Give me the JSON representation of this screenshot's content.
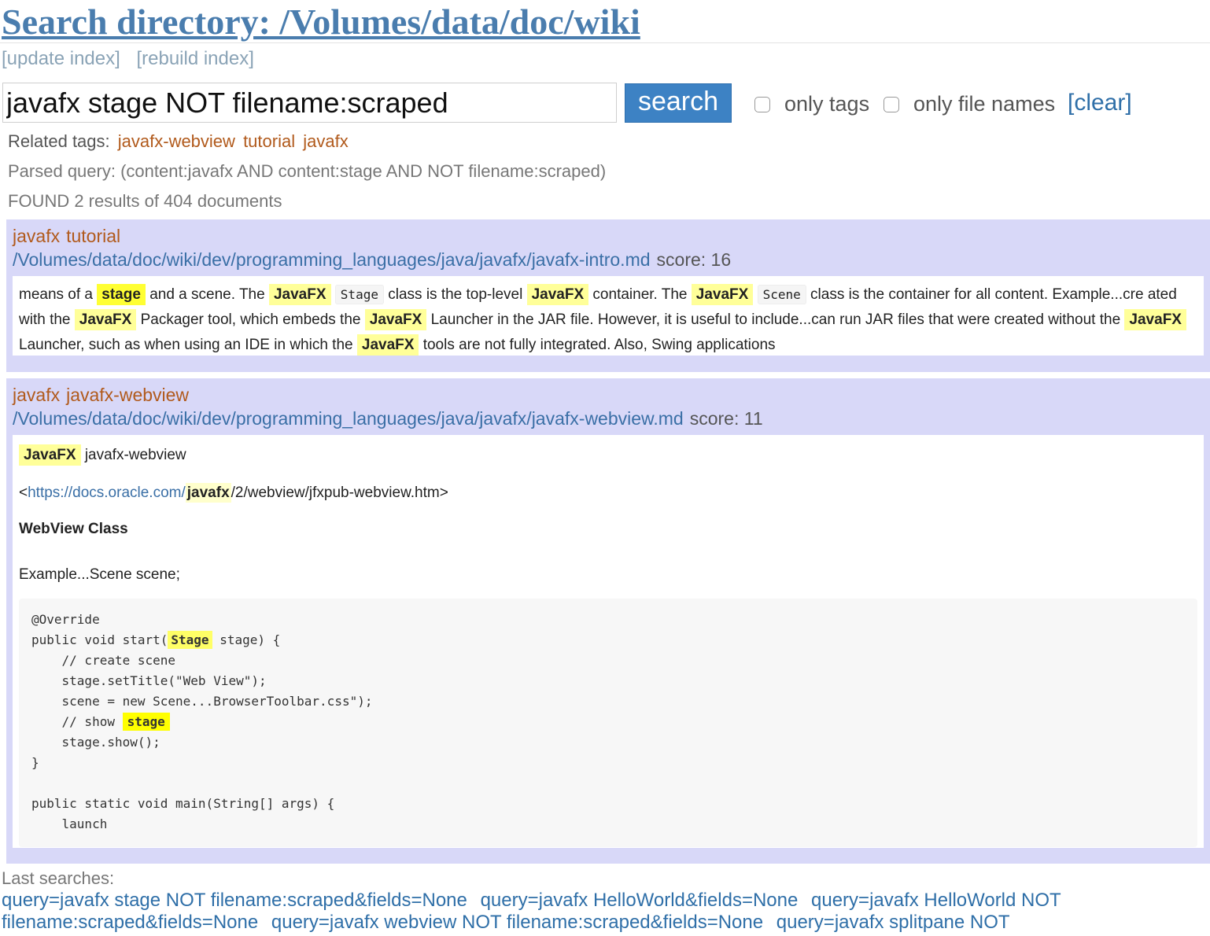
{
  "header": {
    "title": "Search directory: /Volumes/data/doc/wiki",
    "update_index": "[update index]",
    "rebuild_index": "[rebuild index]"
  },
  "search": {
    "query": "javafx stage NOT filename:scraped",
    "button_label": "search",
    "only_tags_label": "only tags",
    "only_file_names_label": "only file names",
    "clear_label": "[clear]"
  },
  "related": {
    "label": "Related tags:",
    "tags": [
      "javafx-webview",
      "tutorial",
      "javafx"
    ]
  },
  "parsed_query": "Parsed query: (content:javafx AND content:stage AND NOT filename:scraped)",
  "found": "FOUND 2 results of 404 documents",
  "results": [
    {
      "tags": [
        "javafx",
        "tutorial"
      ],
      "path": "/Volumes/data/doc/wiki/dev/programming_languages/java/javafx/javafx-intro.md",
      "score": "score: 16",
      "snippet": {
        "t1": "means of a ",
        "hl_stage": "stage",
        "t2": " and a scene. The ",
        "hl_javafx": "JavaFX",
        "code_stage": "Stage",
        "t3": " class is the top-level ",
        "t4": " container. The ",
        "code_scene": "Scene",
        "t5": " class is the container for all content. Example...cre ated with the ",
        "t6": " Packager tool, which embeds the ",
        "t7": " Launcher in the JAR file. However, it is useful to include...can run JAR files that were created without the ",
        "t8": " Launcher, such as when using an IDE in which the ",
        "t9": " tools are not fully integrated. Also, Swing applications"
      }
    },
    {
      "tags": [
        "javafx",
        "javafx-webview"
      ],
      "path": "/Volumes/data/doc/wiki/dev/programming_languages/java/javafx/javafx-webview.md",
      "score": "score: 11",
      "snippet": {
        "hl_javafx": "JavaFX",
        "heading_text": " javafx-webview",
        "url_open": "<",
        "url_prefix": "https://docs.oracle.com/",
        "url_hl": "javafx",
        "url_suffix": "/2/webview/jfxpub-webview.htm>",
        "class_heading": "WebView Class",
        "example": "Example...Scene scene;",
        "code": {
          "l1": "@Override",
          "l2a": "public void start(",
          "l2hl": "Stage",
          "l2b": " stage) {",
          "l3": "    // create scene",
          "l4": "    stage.setTitle(\"Web View\");",
          "l5": "    scene = new Scene...BrowserToolbar.css\");",
          "l6a": "    // show ",
          "l6hl": "stage",
          "l7": "    stage.show();",
          "l8": "}",
          "l9": "",
          "l10": "public static void main(String[] args) {",
          "l11": "    launch"
        }
      }
    }
  ],
  "last_searches": {
    "label": "Last searches:",
    "items": [
      "query=javafx stage NOT filename:scraped&fields=None",
      "query=javafx HelloWorld&fields=None",
      "query=javafx HelloWorld NOT filename:scraped&fields=None",
      "query=javafx webview NOT filename:scraped&fields=None",
      "query=javafx splitpane NOT"
    ]
  }
}
